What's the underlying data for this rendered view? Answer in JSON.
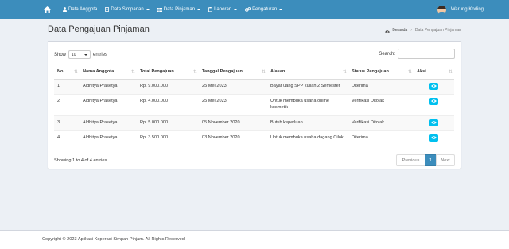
{
  "nav": {
    "items": [
      {
        "label": "Data Anggota",
        "icon": "user-icon",
        "dropdown": false
      },
      {
        "label": "Data Simpanan",
        "icon": "document-icon",
        "dropdown": true
      },
      {
        "label": "Data Pinjaman",
        "icon": "table-icon",
        "dropdown": true
      },
      {
        "label": "Laporan",
        "icon": "clipboard-icon",
        "dropdown": true
      },
      {
        "label": "Pengaturan",
        "icon": "gears-icon",
        "dropdown": true
      }
    ],
    "user_name": "Warung Koding"
  },
  "page": {
    "title": "Data Pengajuan Pinjaman",
    "breadcrumb": {
      "home": "Beranda",
      "current": "Data Pengajuan Pinjaman"
    }
  },
  "table_controls": {
    "show_label": "Show",
    "page_size": "10",
    "entries_label": "entries",
    "search_label": "Search:",
    "search_value": ""
  },
  "table": {
    "columns": [
      "No",
      "Nama Anggota",
      "Total Pengajuan",
      "Tanggal Pengajuan",
      "Alasan",
      "Status Pengajuan",
      "Aksi"
    ],
    "rows": [
      {
        "no": "1",
        "nama": "Aldhitya Prasetya",
        "total": "Rp. 9.000.000",
        "tanggal": "25 Mei 2023",
        "alasan": "Bayar uang SPP kuliah 2 Semester",
        "status": "Diterima"
      },
      {
        "no": "2",
        "nama": "Aldhitya Prasetya",
        "total": "Rp. 4.000.000",
        "tanggal": "25 Mei 2023",
        "alasan": "Untuk membuka usaha online kosmetik",
        "status": "Verifikasi Ditolak"
      },
      {
        "no": "3",
        "nama": "Aldhitya Prasetya",
        "total": "Rp. 5.000.000",
        "tanggal": "05 November 2020",
        "alasan": "Butuh keperluan",
        "status": "Verifikasi Ditolak"
      },
      {
        "no": "4",
        "nama": "Aldhitya Prasetya",
        "total": "Rp. 3.500.000",
        "tanggal": "03 November 2020",
        "alasan": "Untuk membuka usaha dagang Cilok",
        "status": "Diterima"
      }
    ]
  },
  "pagination": {
    "info": "Showing 1 to 4 of 4 entries",
    "previous": "Previous",
    "current_page": "1",
    "next": "Next"
  },
  "footer": {
    "text": "Copyright © 2023 Aplikasi Koperasi Simpan Pinjam. All Rights Reserved"
  },
  "colors": {
    "navbar": "#3c8dbc",
    "background": "#ecf0f5",
    "view_button": "#00c0ef",
    "active_page": "#3c8dbc"
  }
}
